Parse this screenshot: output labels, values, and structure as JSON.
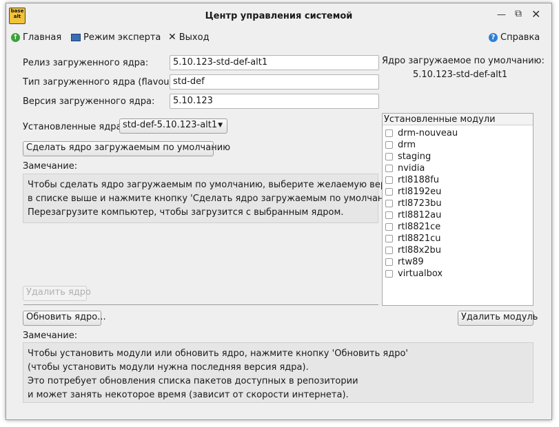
{
  "window": {
    "title": "Центр управления системой",
    "logo_text": "base alt"
  },
  "menu": {
    "home": "Главная",
    "expert": "Режим эксперта",
    "exit": "Выход",
    "help": "Справка"
  },
  "kernel": {
    "release_label": "Релиз загруженного ядра:",
    "release_value": "5.10.123-std-def-alt1",
    "flavour_label": "Тип загруженного ядра (flavour):",
    "flavour_value": "std-def",
    "version_label": "Версия загруженного ядра:",
    "version_value": "5.10.123",
    "default_label": "Ядро загружаемое по умолчанию:",
    "default_value": "5.10.123-std-def-alt1",
    "installed_label": "Установленные ядра:",
    "installed_selected": "std-def-5.10.123-alt1"
  },
  "buttons": {
    "make_default": "Сделать ядро загружаемым по умолчанию",
    "delete_kernel": "Удалить ядро",
    "update_kernel": "Обновить ядро...",
    "delete_module": "Удалить модуль"
  },
  "note1": {
    "label": "Замечание:",
    "lines": [
      "Чтобы сделать ядро загружаемым по умолчанию, выберите желаемую версию",
      "в списке выше и нажмите кнопку 'Сделать ядро загружаемым по умолчанию'.",
      "Перезагрузите компьютер, чтобы загрузится с выбранным ядром."
    ]
  },
  "note2": {
    "label": "Замечание:",
    "lines": [
      "Чтобы установить модули или обновить ядро, нажмите кнопку 'Обновить ядро'",
      "(чтобы установить модули нужна последняя версия ядра).",
      "Это потребует обновления списка пакетов доступных в репозитории",
      "и может занять некоторое время (зависит от скорости интернета)."
    ]
  },
  "modules": {
    "header": "Установленные модули",
    "items": [
      "drm-nouveau",
      "drm",
      "staging",
      "nvidia",
      "rtl8188fu",
      "rtl8192eu",
      "rtl8723bu",
      "rtl8812au",
      "rtl8821ce",
      "rtl8821cu",
      "rtl88x2bu",
      "rtw89",
      "virtualbox"
    ]
  }
}
